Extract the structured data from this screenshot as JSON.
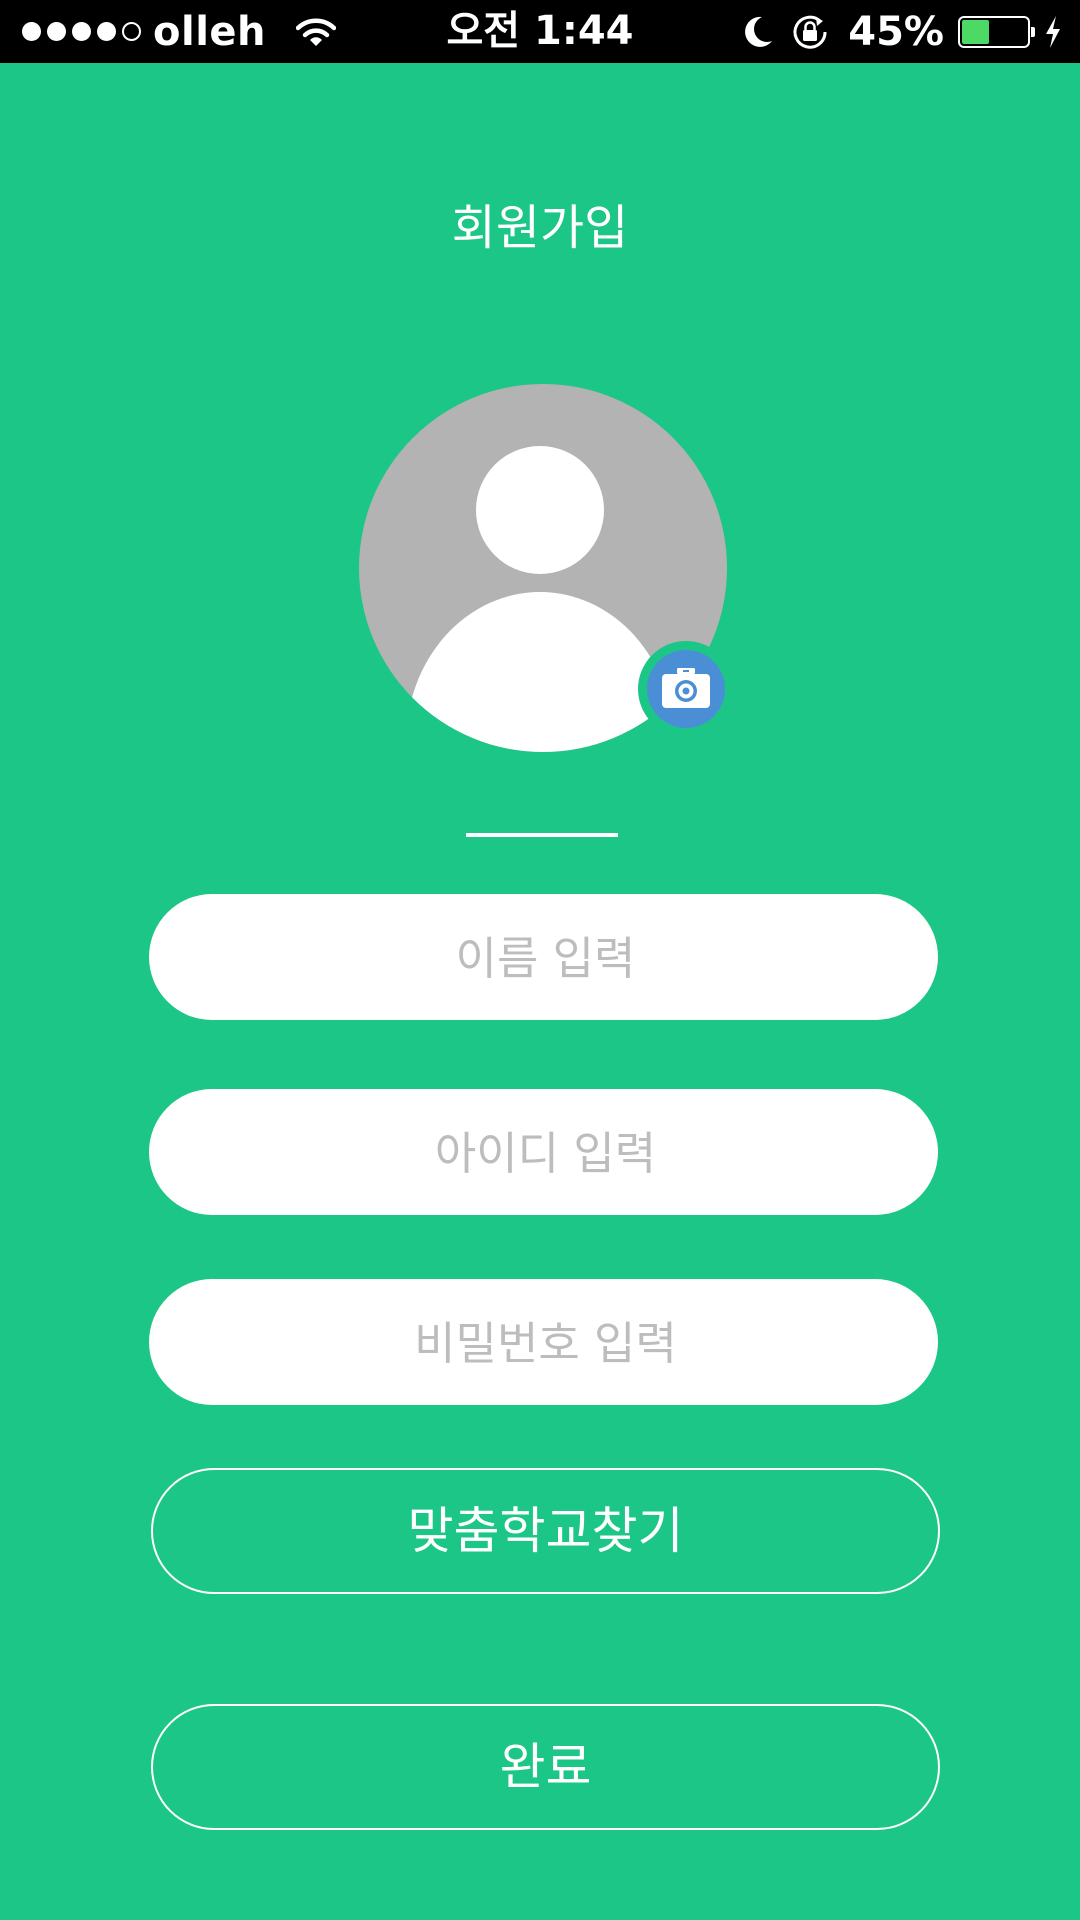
{
  "status_bar": {
    "carrier": "olleh",
    "signal_bars_filled": 4,
    "signal_bars_total": 5,
    "time": "오전 1:44",
    "battery_percent": "45%",
    "battery_level": 0.45,
    "icons": [
      "signal-dots-icon",
      "wifi-icon",
      "moon-icon",
      "rotation-lock-icon",
      "battery-icon",
      "charging-bolt-icon"
    ]
  },
  "header": {
    "title": "회원가입"
  },
  "profile": {
    "avatar_icon": "default-person-avatar",
    "camera_icon": "camera-icon"
  },
  "form": {
    "name_placeholder": "이름 입력",
    "id_placeholder": "아이디 입력",
    "password_placeholder": "비밀번호 입력",
    "school_button_label": "맞춤학교찾기",
    "done_button_label": "완료"
  },
  "colors": {
    "background": "#1bc687",
    "camera_accent": "#4a8fd6",
    "avatar_gray": "#b3b3b3",
    "battery_green": "#4cd964"
  }
}
